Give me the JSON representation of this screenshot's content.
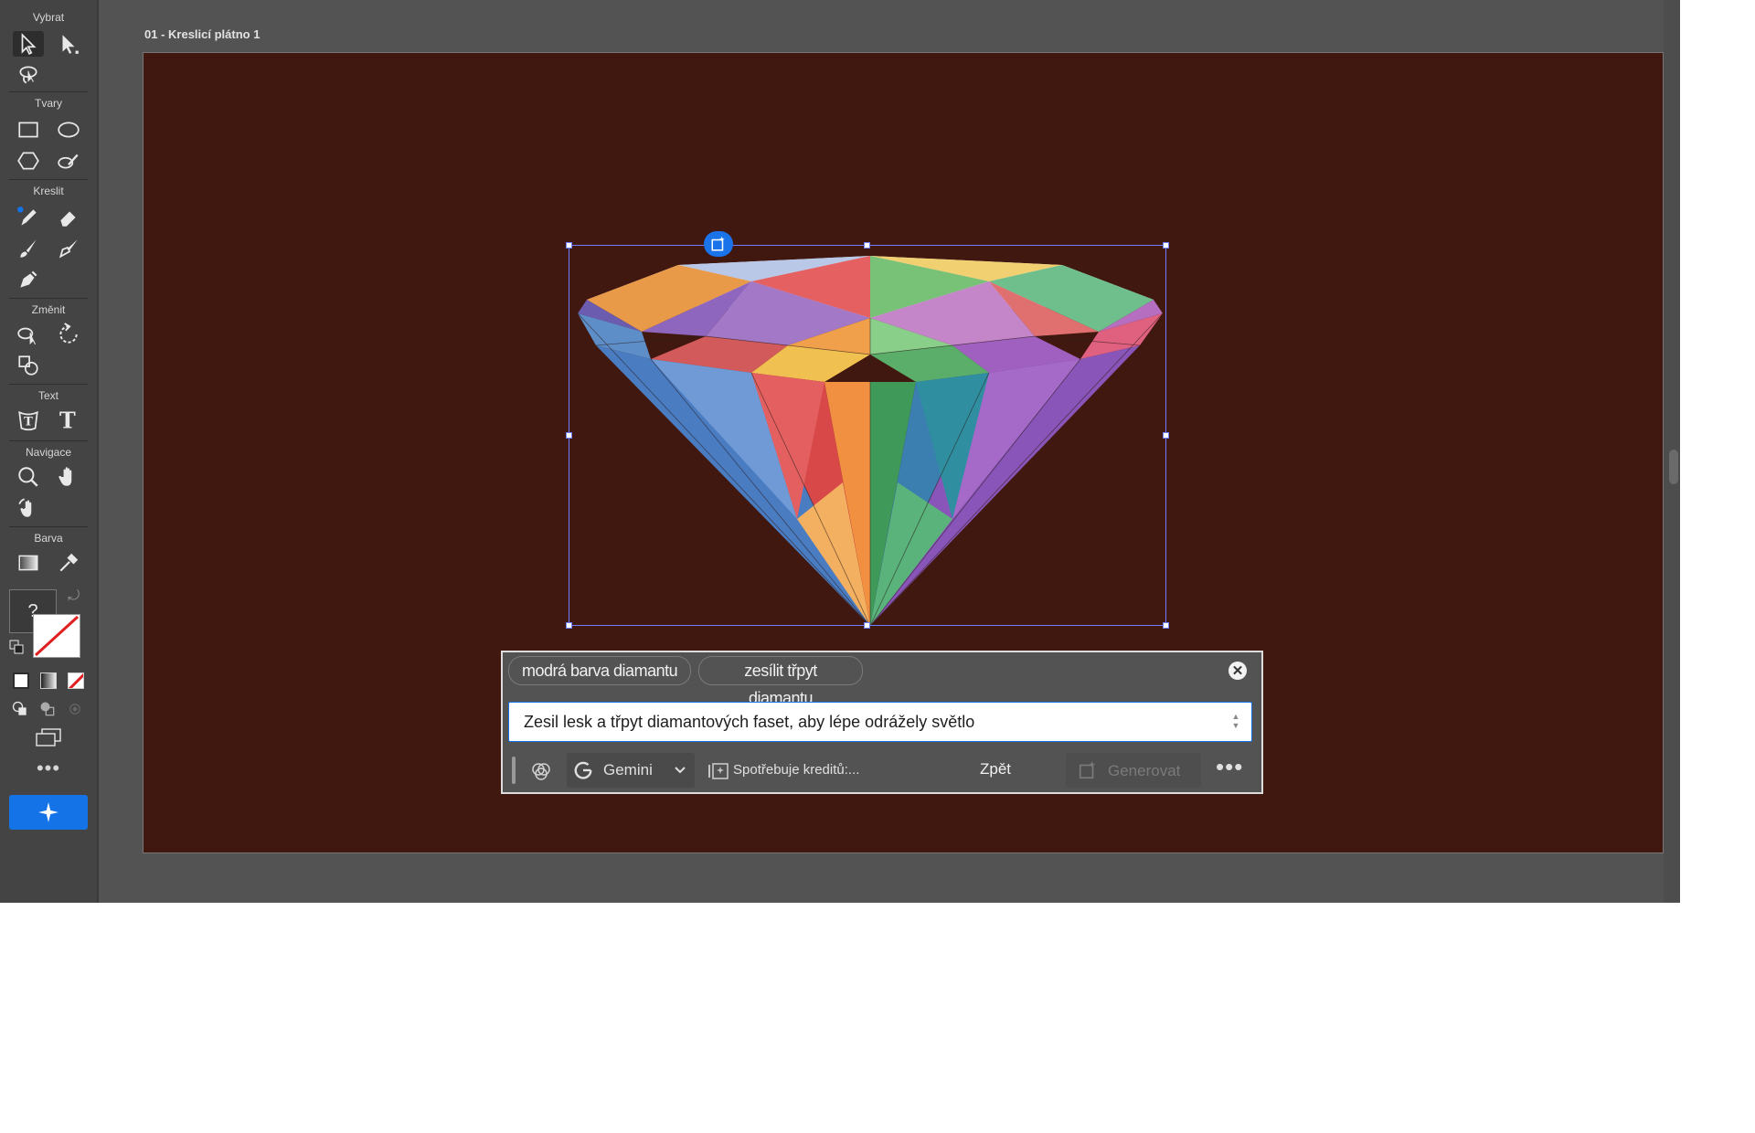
{
  "document": {
    "title": "01 - Kreslicí plátno 1"
  },
  "toolbar": {
    "groups": [
      "Vybrat",
      "Tvary",
      "Kreslit",
      "Změnit",
      "Text",
      "Navigace",
      "Barva"
    ],
    "fill_indicator": "?",
    "more": "•••"
  },
  "artboard": {
    "background": "#411810"
  },
  "prompt_panel": {
    "suggestions": [
      "modrá barva diamantu",
      "zesílit třpyt diamantu"
    ],
    "prompt_value": "Zesil lesk a třpyt diamantových faset, aby lépe odrážely světlo",
    "model": "Gemini",
    "credits": "Spotřebuje kreditů:...",
    "back_label": "Zpět",
    "generate_label": "Generovat",
    "more": "•••"
  },
  "colors": {
    "accent": "#1473e6",
    "selection": "#6b7fff"
  }
}
